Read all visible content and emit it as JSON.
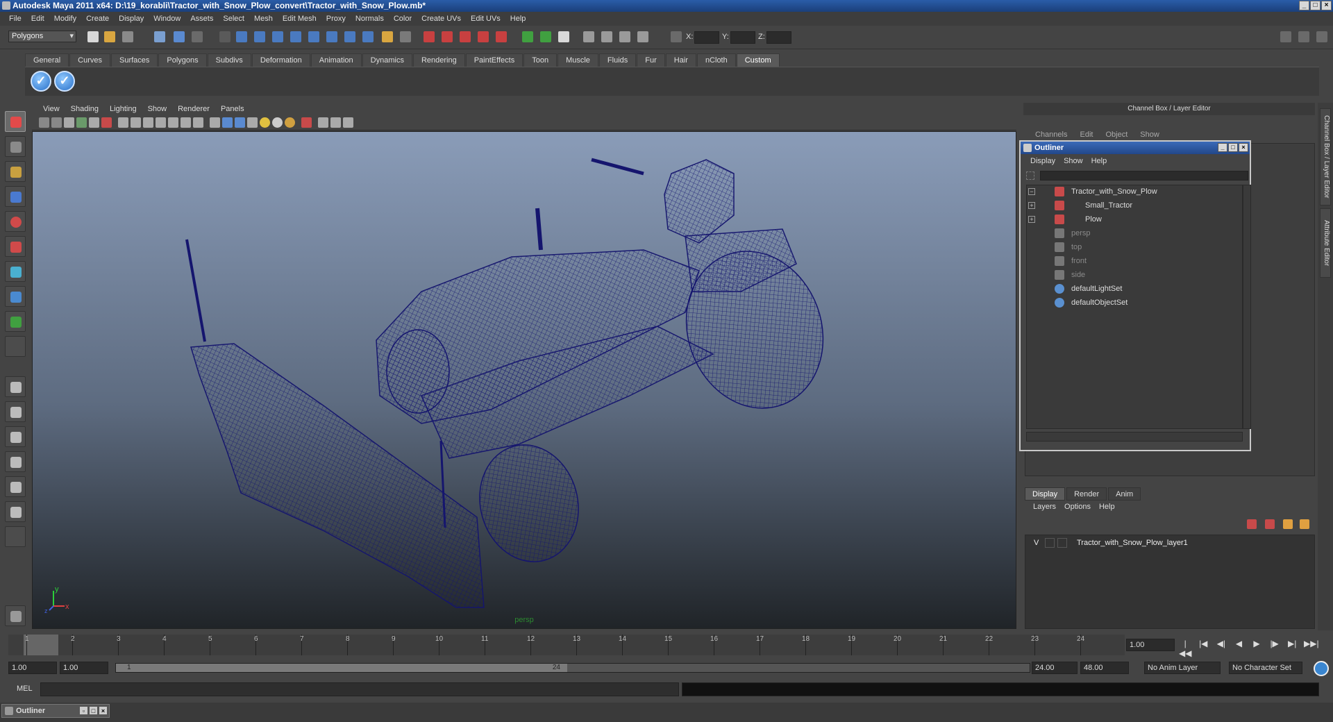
{
  "window": {
    "title": "Autodesk Maya 2011 x64: D:\\19_korabli\\Tractor_with_Snow_Plow_convert\\Tractor_with_Snow_Plow.mb*",
    "minimize": "_",
    "maximize": "□",
    "close": "×"
  },
  "menubar": [
    "File",
    "Edit",
    "Modify",
    "Create",
    "Display",
    "Window",
    "Assets",
    "Select",
    "Mesh",
    "Edit Mesh",
    "Proxy",
    "Normals",
    "Color",
    "Create UVs",
    "Edit UVs",
    "Help"
  ],
  "statusline": {
    "mode": "Polygons",
    "x_label": "X:",
    "y_label": "Y:",
    "z_label": "Z:"
  },
  "shelf": {
    "tabs": [
      "General",
      "Curves",
      "Surfaces",
      "Polygons",
      "Subdivs",
      "Deformation",
      "Animation",
      "Dynamics",
      "Rendering",
      "PaintEffects",
      "Toon",
      "Muscle",
      "Fluids",
      "Fur",
      "Hair",
      "nCloth",
      "Custom"
    ],
    "active_tab": "Custom",
    "button_glyph": "✓"
  },
  "viewport": {
    "menu": [
      "View",
      "Shading",
      "Lighting",
      "Show",
      "Renderer",
      "Panels"
    ],
    "camera_label": "persp",
    "axis_y": "y",
    "axis_x": "x",
    "axis_z": "z",
    "colors": {
      "wire": "#1a1a7a",
      "bg_top": "#8a9cb8",
      "bg_bottom": "#202428"
    }
  },
  "channel_box": {
    "title": "Channel Box / Layer Editor",
    "menu": [
      "Channels",
      "Edit",
      "Object",
      "Show"
    ]
  },
  "side_tabs": {
    "channel": "Channel Box / Layer Editor",
    "attribute": "Attribute Editor"
  },
  "outliner": {
    "title": "Outliner",
    "menu": [
      "Display",
      "Show",
      "Help"
    ],
    "items": [
      {
        "label": "Tractor_with_Snow_Plow",
        "expand": "−",
        "dim": false
      },
      {
        "label": "Small_Tractor",
        "expand": "+",
        "dim": false
      },
      {
        "label": "Plow",
        "expand": "+",
        "dim": false
      },
      {
        "label": "persp",
        "expand": "",
        "dim": true
      },
      {
        "label": "top",
        "expand": "",
        "dim": true
      },
      {
        "label": "front",
        "expand": "",
        "dim": true
      },
      {
        "label": "side",
        "expand": "",
        "dim": true
      },
      {
        "label": "defaultLightSet",
        "expand": "",
        "dim": false
      },
      {
        "label": "defaultObjectSet",
        "expand": "",
        "dim": false
      }
    ]
  },
  "layer_editor": {
    "tabs": [
      "Display",
      "Render",
      "Anim"
    ],
    "active_tab": "Display",
    "menu": [
      "Layers",
      "Options",
      "Help"
    ],
    "layers": [
      {
        "visible": "V",
        "name": "Tractor_with_Snow_Plow_layer1"
      }
    ]
  },
  "timeline": {
    "ticks": [
      "1",
      "2",
      "3",
      "4",
      "5",
      "6",
      "7",
      "8",
      "9",
      "10",
      "11",
      "12",
      "13",
      "14",
      "15",
      "16",
      "17",
      "18",
      "19",
      "20",
      "21",
      "22",
      "23",
      "24"
    ],
    "current_frame": "1.00",
    "play_controls": [
      "|◀◀",
      "|◀",
      "◀|",
      "◀",
      "▶",
      "|▶",
      "▶|",
      "▶▶|"
    ]
  },
  "range": {
    "start": "1.00",
    "start2": "1.00",
    "handle_start": "1",
    "handle_end": "24",
    "end": "24.00",
    "end2": "48.00",
    "anim_layer": "No Anim Layer",
    "character_set": "No Character Set"
  },
  "command_line": {
    "label": "MEL"
  },
  "taskbar": {
    "outliner_label": "Outliner"
  }
}
